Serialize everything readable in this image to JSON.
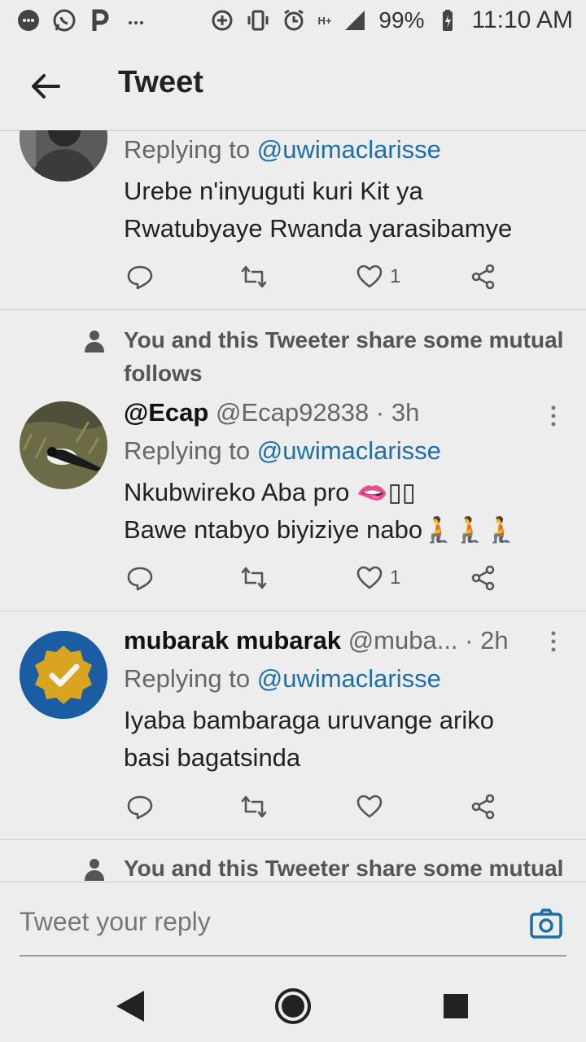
{
  "status_bar": {
    "battery_percent": "99%",
    "time": "11:10 AM",
    "network": "H+",
    "icons": [
      "messaging-icon",
      "whatsapp-icon",
      "p-app-icon",
      "more-dots-icon",
      "data-saver-icon",
      "vibrate-icon",
      "alarm-icon",
      "signal-icon",
      "battery-icon"
    ]
  },
  "header": {
    "title": "Tweet"
  },
  "tweets": [
    {
      "replying_prefix": "Replying to",
      "replying_to": "@uwimaclarisse",
      "text_lines": [
        "Urebe n'inyuguti kuri Kit ya",
        "Rwatubyaye Rwanda yarasibamye"
      ],
      "like_count": "1"
    },
    {
      "social_context": "You and this Tweeter share some mutual",
      "social_context_line2": "follows",
      "display_name": "@Ecap",
      "handle_time": "@Ecap92838 · 3h",
      "replying_prefix": "Replying to",
      "replying_to": "@uwimaclarisse",
      "text_lines": [
        "Nkubwireko Aba pro 🫦▯▯",
        "Bawe ntabyo biyiziye nabo"
      ],
      "emoji": "🧎🧎🧎",
      "like_count": "1"
    },
    {
      "display_name": "mubarak mubarak",
      "handle": "@muba...",
      "time": "· 2h",
      "replying_prefix": "Replying to",
      "replying_to": "@uwimaclarisse",
      "text_lines": [
        "Iyaba bambaraga uruvange ariko",
        "basi bagatsinda"
      ],
      "like_count": ""
    }
  ],
  "partial_social_context": "You and this Tweeter share some mutual",
  "composer": {
    "placeholder": "Tweet your reply"
  },
  "colors": {
    "link": "#1d6fa8",
    "background": "#ededed",
    "emoji_accent": "#b03bb0"
  }
}
